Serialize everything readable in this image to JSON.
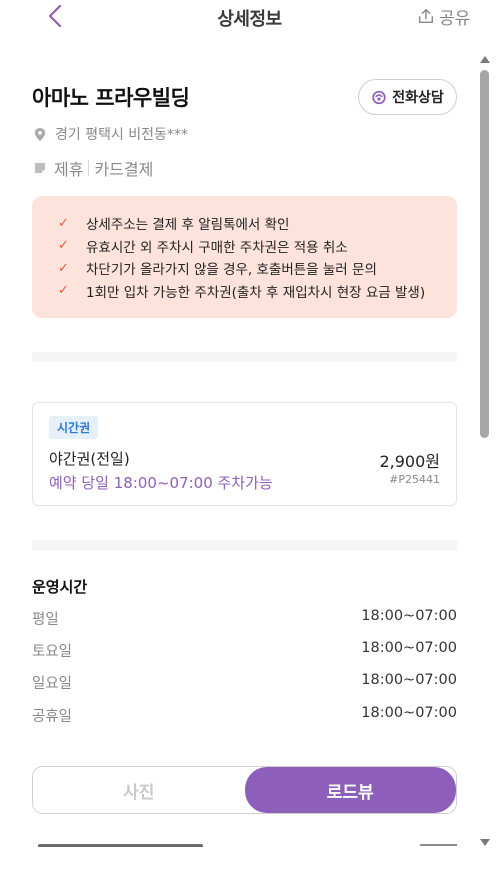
{
  "header": {
    "title": "상세정보",
    "share_label": "공유",
    "back_icon": "chevron-left-icon",
    "share_icon": "share-upload-icon"
  },
  "place": {
    "name": "아마노 프라우빌딩",
    "phone_button": "전화상담",
    "address": "경기 평택시 비전동***",
    "tags": [
      "제휴",
      "카드결제"
    ]
  },
  "notices": [
    "상세주소는 결제 후 알림톡에서 확인",
    "유효시간 외 주차시 구매한 주차권은 적용 취소",
    "차단기가 올라가지 않을 경우, 호출버튼을 눌러 문의",
    "1회만 입차 가능한 주차권(출차 후 재입차시 현장 요금 발생)"
  ],
  "ticket": {
    "badge": "시간권",
    "name": "야간권(전일)",
    "price": "2,900원",
    "time": "예약 당일 18:00~07:00 주차가능",
    "code": "#P25441"
  },
  "hours": {
    "title": "운영시간",
    "rows": [
      {
        "day": "평일",
        "time": "18:00~07:00"
      },
      {
        "day": "토요일",
        "time": "18:00~07:00"
      },
      {
        "day": "일요일",
        "time": "18:00~07:00"
      },
      {
        "day": "공휴일",
        "time": "18:00~07:00"
      }
    ]
  },
  "view_tabs": {
    "photo": "사진",
    "roadview": "로드뷰",
    "selected": "로드뷰"
  },
  "colors": {
    "accent": "#8e5fba",
    "notice_bg": "#fde3dc",
    "check": "#e25a3f",
    "badge_bg": "#e6f0fb",
    "badge_text": "#2f78d4"
  }
}
